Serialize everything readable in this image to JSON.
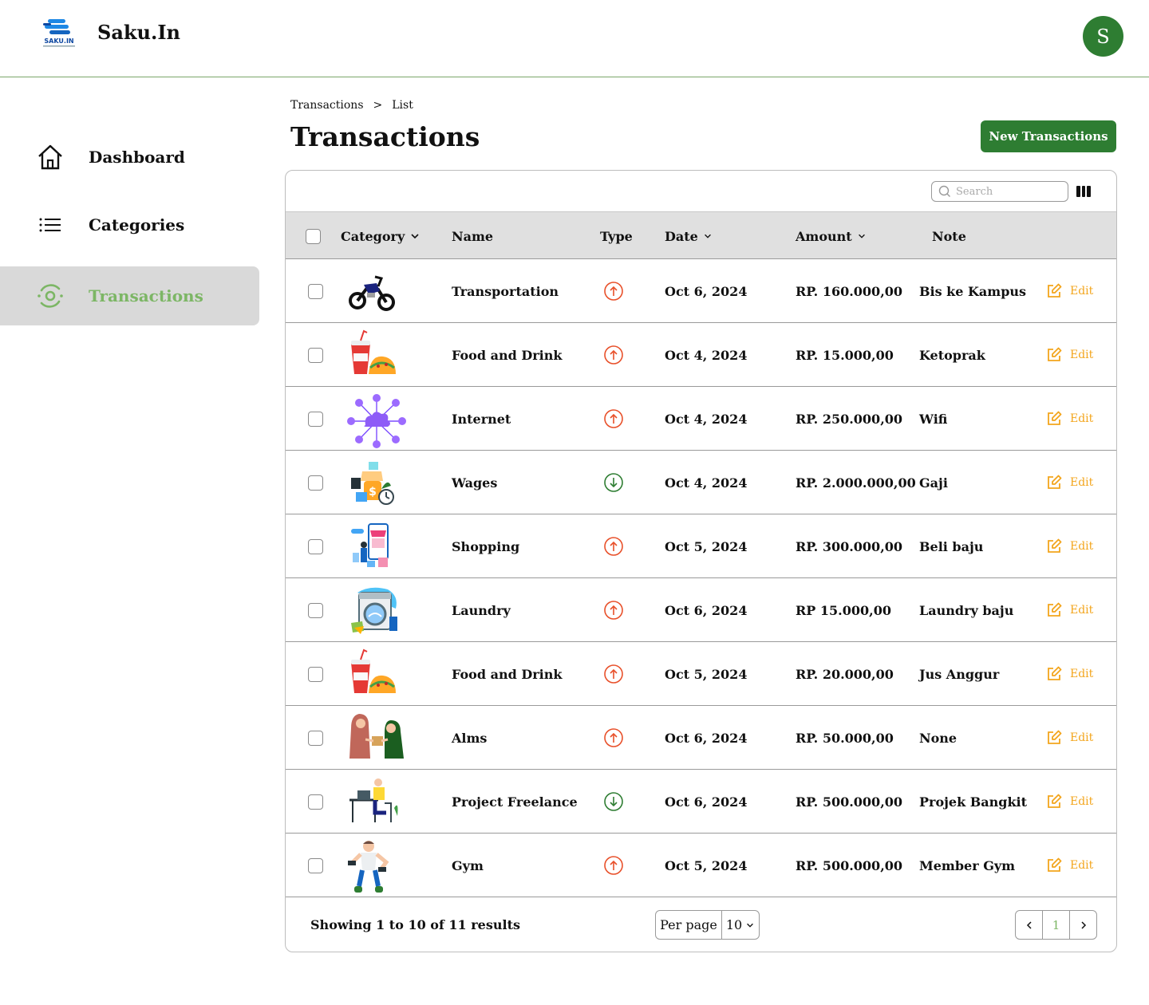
{
  "app": {
    "name": "Saku.In",
    "logo_text": "SAKU.IN",
    "avatar_initial": "S"
  },
  "sidebar": {
    "items": [
      {
        "label": "Dashboard",
        "icon": "home-icon",
        "active": false
      },
      {
        "label": "Categories",
        "icon": "list-icon",
        "active": false
      },
      {
        "label": "Transactions",
        "icon": "transactions-icon",
        "active": true
      }
    ]
  },
  "breadcrumb": {
    "items": [
      "Transactions",
      "List"
    ],
    "separator": ">"
  },
  "page": {
    "title": "Transactions",
    "new_button": "New Transactions"
  },
  "toolbar": {
    "search_placeholder": "Search"
  },
  "table": {
    "columns": [
      "Category",
      "Name",
      "Type",
      "Date",
      "Amount",
      "Note"
    ],
    "edit_label": "Edit",
    "rows": [
      {
        "image": "motorcycle",
        "name": "Transportation",
        "type": "expense",
        "date": "Oct 6, 2024",
        "amount": "RP. 160.000,00",
        "note": "Bis ke Kampus"
      },
      {
        "image": "food",
        "name": "Food and Drink",
        "type": "expense",
        "date": "Oct 4, 2024",
        "amount": "RP. 15.000,00",
        "note": "Ketoprak"
      },
      {
        "image": "cloud-network",
        "name": "Internet",
        "type": "expense",
        "date": "Oct 4, 2024",
        "amount": "RP. 250.000,00",
        "note": "Wifi"
      },
      {
        "image": "money",
        "name": "Wages",
        "type": "income",
        "date": "Oct 4, 2024",
        "amount": "RP. 2.000.000,00",
        "note": "Gaji"
      },
      {
        "image": "shopping",
        "name": "Shopping",
        "type": "expense",
        "date": "Oct 5, 2024",
        "amount": "RP. 300.000,00",
        "note": "Beli baju"
      },
      {
        "image": "washing-machine",
        "name": "Laundry",
        "type": "expense",
        "date": "Oct 6, 2024",
        "amount": "RP 15.000,00",
        "note": "Laundry baju"
      },
      {
        "image": "food",
        "name": "Food and Drink",
        "type": "expense",
        "date": "Oct 5, 2024",
        "amount": "RP. 20.000,00",
        "note": "Jus Anggur"
      },
      {
        "image": "giving",
        "name": "Alms",
        "type": "expense",
        "date": "Oct 6, 2024",
        "amount": "RP. 50.000,00",
        "note": "None"
      },
      {
        "image": "laptop-worker",
        "name": "Project Freelance",
        "type": "income",
        "date": "Oct 6, 2024",
        "amount": "RP. 500.000,00",
        "note": "Projek Bangkit"
      },
      {
        "image": "gym",
        "name": "Gym",
        "type": "expense",
        "date": "Oct 5, 2024",
        "amount": "RP. 500.000,00",
        "note": "Member Gym"
      }
    ]
  },
  "footer": {
    "showing": "Showing 1 to 10 of 11 results",
    "per_page_label": "Per page",
    "per_page_value": "10",
    "current_page": "1"
  },
  "colors": {
    "primary": "#2e7d32",
    "active_nav": "#7cb665",
    "expense": "#e8502a",
    "income": "#2e7d32",
    "edit": "#f3a51c"
  }
}
